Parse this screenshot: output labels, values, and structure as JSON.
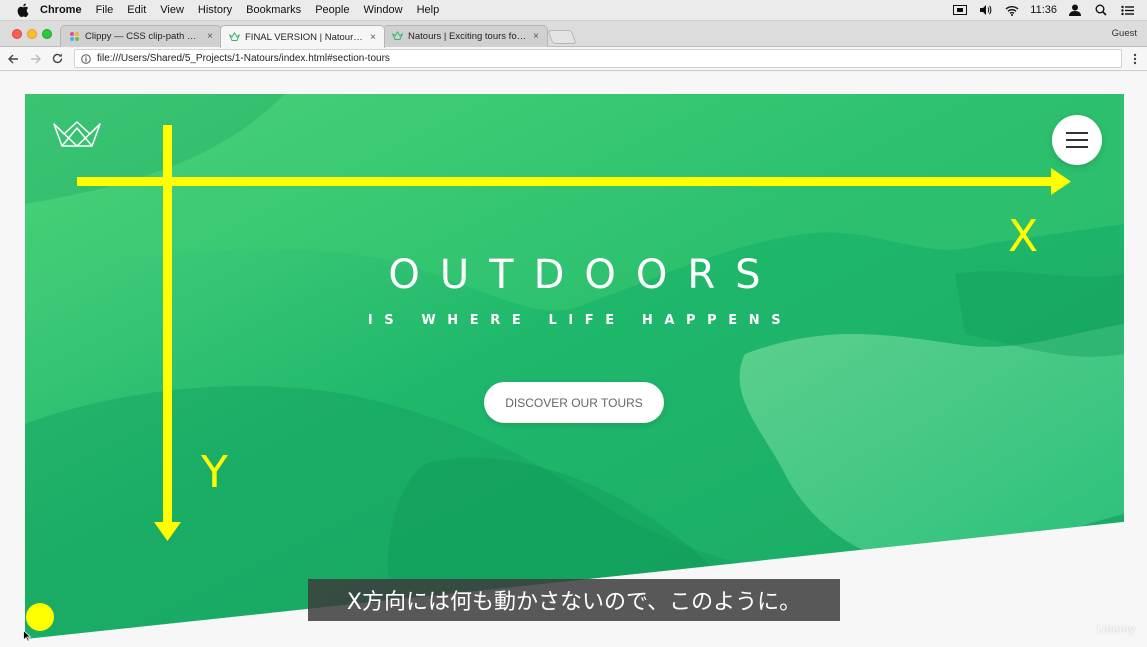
{
  "menubar": {
    "app_name": "Chrome",
    "items": [
      "File",
      "Edit",
      "View",
      "History",
      "Bookmarks",
      "People",
      "Window",
      "Help"
    ],
    "time": "11:36",
    "icons": [
      "apple-icon",
      "screen-mirror-icon",
      "volume-icon",
      "wifi-icon",
      "user-icon",
      "spotlight-search-icon",
      "notification-list-icon"
    ]
  },
  "tabs": [
    {
      "title": "Clippy — CSS clip-path maker",
      "close": "×",
      "active": false
    },
    {
      "title": "FINAL VERSION | Natours | Exciting tours for adventurous people",
      "close": "×",
      "active": true
    },
    {
      "title": "Natours | Exciting tours for adventurous people",
      "close": "×",
      "active": false
    }
  ],
  "profile": "Guest",
  "address_bar": {
    "url": "file:///Users/Shared/5_Projects/1-Natours/index.html#section-tours"
  },
  "hero": {
    "title": "OUTDOORS",
    "subtitle": "IS WHERE LIFE HAPPENS",
    "cta_label": "DISCOVER OUR TOURS",
    "colors": {
      "gradient_light": "#55d67f",
      "gradient_dark": "#19a864"
    }
  },
  "annotation": {
    "x_label": "X",
    "y_label": "Y",
    "color": "#ffff00"
  },
  "caption": "X方向には何も動かさないので、このように。",
  "watermark": "Udemy"
}
